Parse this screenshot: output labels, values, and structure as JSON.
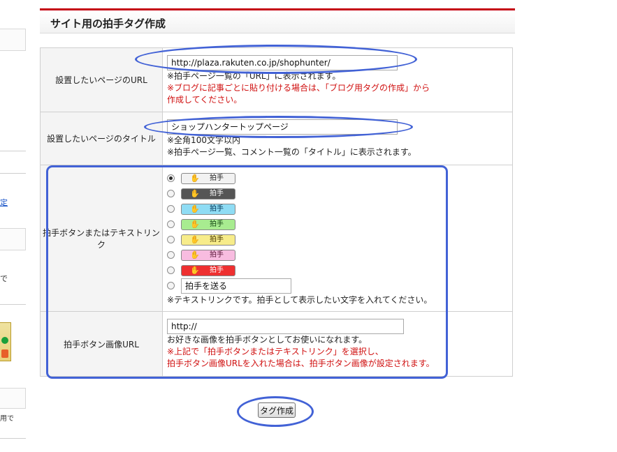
{
  "colors": {
    "accent": "#c40010",
    "annotation": "#4262d6",
    "note_red": "#d01010"
  },
  "left_sidebar": {
    "link_fragment": "定",
    "fragment_2": "で",
    "footer_fragment": "用で"
  },
  "header": {
    "title": "サイト用の拍手タグ作成"
  },
  "form": {
    "url_row": {
      "label": "設置したいページのURL",
      "value": "http://plaza.rakuten.co.jp/shophunter/",
      "note": "※拍手ページ一覧の「URL」に表示されます。",
      "red_note_1": "※ブログに記事ごとに貼り付ける場合は、「ブログ用タグの作成」から",
      "red_note_2": "作成してください。"
    },
    "title_row": {
      "label": "設置したいページのタイトル",
      "value": "ショップハンタートップページ",
      "note_1": "※全角100文字以内",
      "note_2": "※拍手ページ一覧、コメント一覧の「タイトル」に表示されます。"
    },
    "button_row": {
      "label": "拍手ボタンまたはテキストリンク",
      "button_text": "拍手",
      "hand_glyph": "✋",
      "options": [
        {
          "bg": "#f2f2f2",
          "fg": "#222222",
          "selected": true
        },
        {
          "bg": "#555555",
          "fg": "#ffffff",
          "selected": false
        },
        {
          "bg": "#8fdcf4",
          "fg": "#003355",
          "selected": false
        },
        {
          "bg": "#a8ec90",
          "fg": "#114411",
          "selected": false
        },
        {
          "bg": "#f7ec8a",
          "fg": "#443300",
          "selected": false
        },
        {
          "bg": "#f8bce0",
          "fg": "#551133",
          "selected": false
        },
        {
          "bg": "#ee3030",
          "fg": "#ffffff",
          "selected": false
        }
      ],
      "text_link_value": "拍手を送る",
      "note": "※テキストリンクです。拍手として表示したい文字を入れてください。"
    },
    "image_row": {
      "label": "拍手ボタン画像URL",
      "value": "http://",
      "note": "お好きな画像を拍手ボタンとしてお使いになれます。",
      "red_note_1": "※上記で「拍手ボタンまたはテキストリンク」を選択し、",
      "red_note_2": "拍手ボタン画像URLを入れた場合は、拍手ボタン画像が設定されます。"
    }
  },
  "submit": {
    "label": "タグ作成"
  }
}
